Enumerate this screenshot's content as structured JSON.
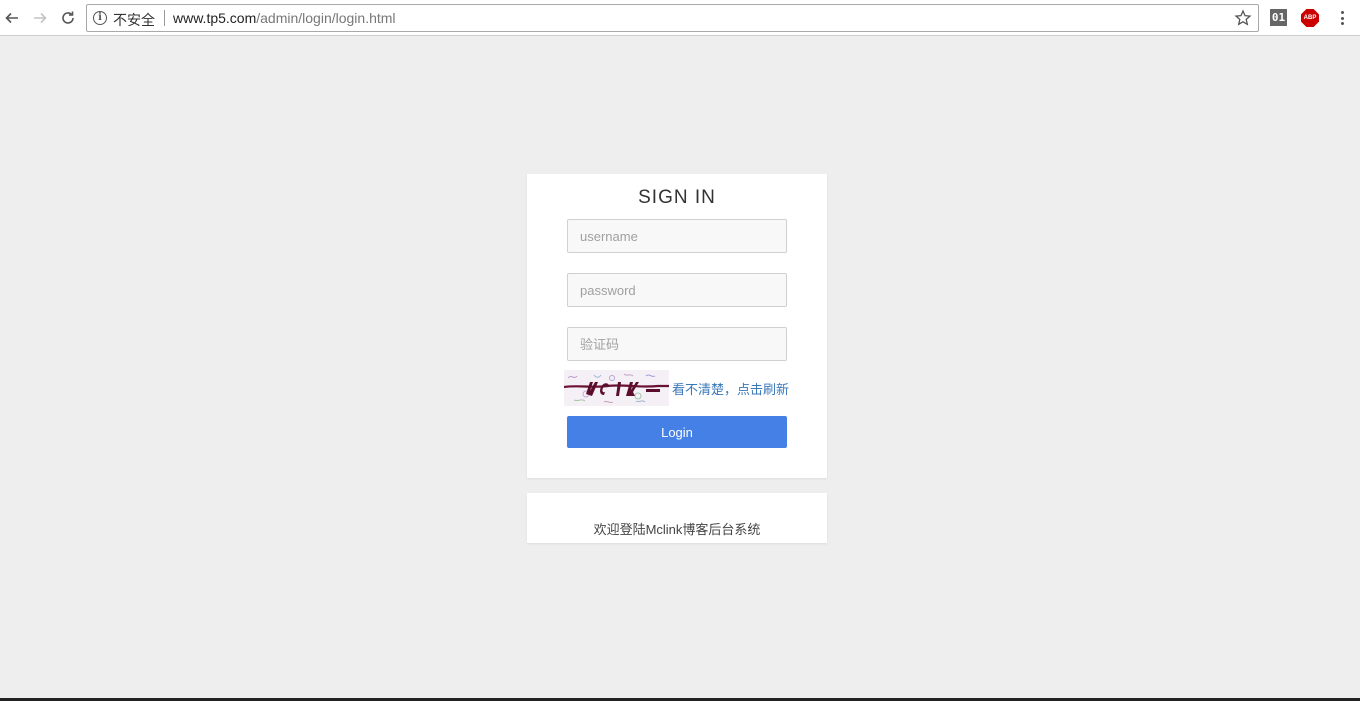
{
  "browser": {
    "security_label": "不安全",
    "url_host": "www.tp5.com",
    "url_path": "/admin/login/login.html",
    "extension_01_label": "01",
    "extension_abp_label": "ABP"
  },
  "login": {
    "title": "SIGN IN",
    "username_placeholder": "username",
    "password_placeholder": "password",
    "captcha_placeholder": "验证码",
    "captcha_refresh_text": "看不清楚，点击刷新",
    "login_button_label": "Login"
  },
  "footer": {
    "welcome_text": "欢迎登陆Mclink博客后台系统"
  },
  "colors": {
    "page_background": "#eeeeee",
    "accent": "#4580e6",
    "link": "#3a78b8"
  }
}
